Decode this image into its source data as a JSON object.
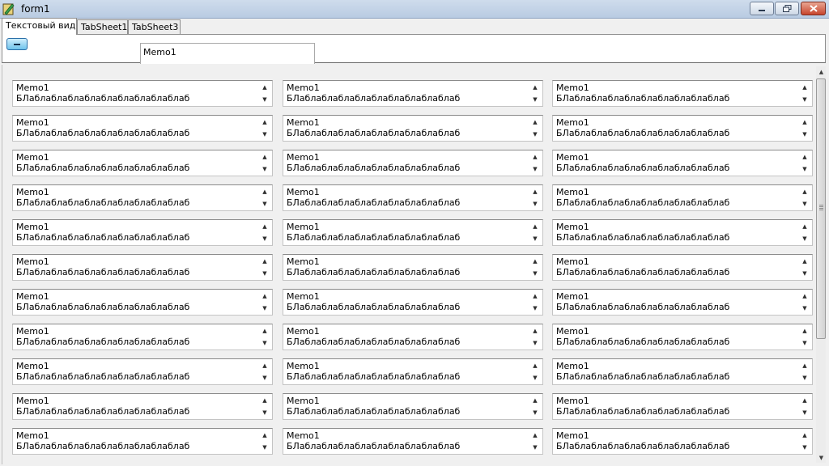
{
  "window": {
    "title": "form1"
  },
  "icons": {
    "app": "app-icon",
    "minimize": "minimize-icon",
    "maximize": "maximize-icon",
    "close": "close-icon",
    "up": "▲",
    "down": "▼"
  },
  "tabs": [
    {
      "label": "Текстовый вид",
      "active": true
    },
    {
      "label": "TabSheet1",
      "active": false
    },
    {
      "label": "TabSheet3",
      "active": false
    }
  ],
  "top_panel": {
    "memo_text": "Memo1"
  },
  "memo_grid": {
    "rows": 11,
    "columns": 3,
    "line1": "Memo1",
    "line2": "БЛаблаблаблаблаблаблаблаблаблаб"
  },
  "colors": {
    "close_button": "#c7452d",
    "accent": "#6fc3ec"
  }
}
